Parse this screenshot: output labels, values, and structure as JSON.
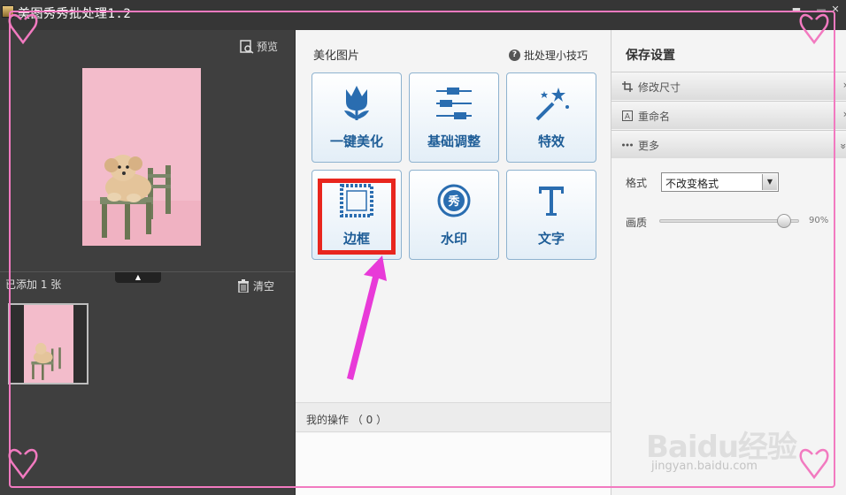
{
  "window": {
    "title": "美图秀秀批处理1.2",
    "controls": [
      "minimize",
      "close"
    ]
  },
  "left_panel": {
    "preview_label": "预览",
    "added_text": "已添加 1 张",
    "clear_label": "清空"
  },
  "center_panel": {
    "title": "美化图片",
    "tips_label": "批处理小技巧",
    "tools": [
      {
        "label": "一键美化",
        "icon": "tulip-icon"
      },
      {
        "label": "基础调整",
        "icon": "sliders-icon"
      },
      {
        "label": "特效",
        "icon": "magic-wand-icon"
      },
      {
        "label": "边框",
        "icon": "border-frame-icon"
      },
      {
        "label": "水印",
        "icon": "watermark-stamp-icon"
      },
      {
        "label": "文字",
        "icon": "text-t-icon"
      }
    ],
    "highlighted_tool": "边框",
    "operations_label": "我的操作 （ 0 ）"
  },
  "right_panel": {
    "title": "保存设置",
    "sections": [
      {
        "label": "修改尺寸",
        "icon": "crop-icon"
      },
      {
        "label": "重命名",
        "icon": "rename-icon"
      },
      {
        "label": "更多",
        "icon": "more-dots-icon"
      }
    ],
    "format_label": "格式",
    "format_value": "不改变格式",
    "quality_label": "画质",
    "quality_value": "90%",
    "quality_level": 0.9
  },
  "watermark": {
    "brand": "Baidu经验",
    "url": "jingyan.baidu.com"
  },
  "colors": {
    "accent_blue": "#1e5d97",
    "highlight_red": "#e8261e",
    "arrow_magenta": "#e83ad8",
    "border_pink": "#f27ac0"
  }
}
